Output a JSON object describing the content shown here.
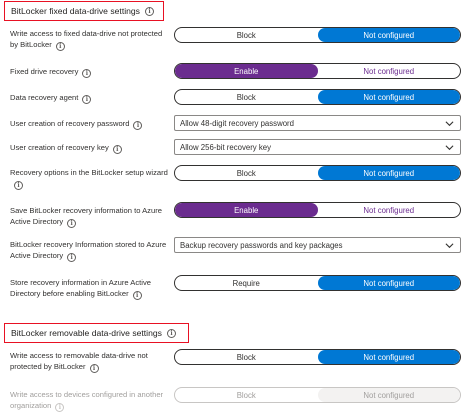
{
  "fixed_section": {
    "title": "BitLocker fixed data-drive settings"
  },
  "fixed_settings": [
    {
      "label": "Write access to fixed data-drive not protected by BitLocker",
      "type": "toggle",
      "options": [
        "Block",
        "Not configured"
      ],
      "selected": "Not configured"
    },
    {
      "label": "Fixed drive recovery",
      "type": "toggle",
      "options": [
        "Enable",
        "Not configured"
      ],
      "selected": "Enable"
    },
    {
      "label": "Data recovery agent",
      "type": "toggle",
      "options": [
        "Block",
        "Not configured"
      ],
      "selected": "Not configured"
    },
    {
      "label": "User creation of recovery password",
      "type": "dropdown",
      "value": "Allow 48-digit recovery password"
    },
    {
      "label": "User creation of recovery key",
      "type": "dropdown",
      "value": "Allow 256-bit recovery key"
    },
    {
      "label": "Recovery options in the BitLocker setup wizard",
      "type": "toggle",
      "options": [
        "Block",
        "Not configured"
      ],
      "selected": "Not configured"
    },
    {
      "label": "Save BitLocker recovery information to Azure Active Directory",
      "type": "toggle",
      "options": [
        "Enable",
        "Not configured"
      ],
      "selected": "Enable"
    },
    {
      "label": "BitLocker recovery Information stored to Azure Active Directory",
      "type": "dropdown",
      "value": "Backup recovery passwords and key packages"
    },
    {
      "label": "Store recovery information in Azure Active Directory before enabling BitLocker",
      "type": "toggle",
      "options": [
        "Require",
        "Not configured"
      ],
      "selected": "Not configured"
    }
  ],
  "removable_section": {
    "title": "BitLocker removable data-drive settings"
  },
  "removable_settings": [
    {
      "label": "Write access to removable data-drive not protected by BitLocker",
      "type": "toggle",
      "options": [
        "Block",
        "Not configured"
      ],
      "selected": "Not configured"
    },
    {
      "label": "Write access to devices configured in another organization",
      "type": "toggle",
      "options": [
        "Block",
        "Not configured"
      ],
      "selected": "Not configured",
      "disabled": true
    }
  ],
  "colors": {
    "accent_blue": "#0078d4",
    "accent_purple": "#6b2c8f",
    "highlight_border": "#e81123"
  },
  "icons": {
    "info": "info-circle-icon",
    "dropdown": "chevron-down-icon"
  }
}
